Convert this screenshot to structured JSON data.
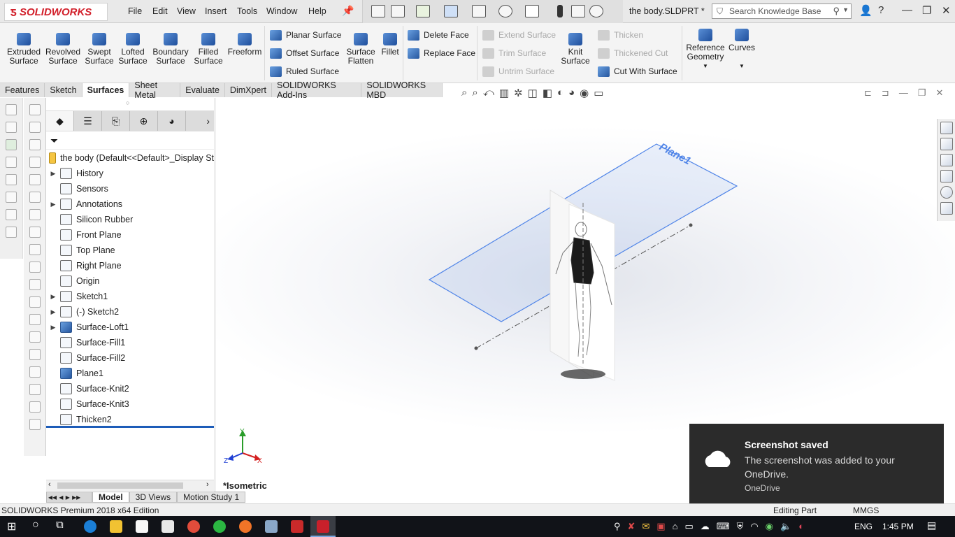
{
  "app": {
    "logo_text": "SOLIDWORKS",
    "document_title": "the body.SLDPRT *",
    "menu": [
      "File",
      "Edit",
      "View",
      "Insert",
      "Tools",
      "Window",
      "Help"
    ],
    "search_placeholder": "Search Knowledge Base"
  },
  "commands": {
    "large": [
      "Extruded\nSurface",
      "Revolved\nSurface",
      "Swept\nSurface",
      "Lofted\nSurface",
      "Boundary\nSurface",
      "Filled\nSurface",
      "Freeform"
    ],
    "group1": [
      "Planar Surface",
      "Offset Surface",
      "Ruled Surface"
    ],
    "surface_flatten": "Surface\nFlatten",
    "fillet": "Fillet",
    "group2": [
      "Delete Face",
      "Replace Face"
    ],
    "group3_disabled": [
      "Extend Surface",
      "Trim Surface",
      "Untrim Surface"
    ],
    "knit_surface": "Knit\nSurface",
    "group4": [
      {
        "label": "Thicken",
        "enabled": false
      },
      {
        "label": "Thickened Cut",
        "enabled": false
      },
      {
        "label": "Cut With Surface",
        "enabled": true
      }
    ],
    "reference_geometry": "Reference\nGeometry",
    "curves": "Curves"
  },
  "tabs": [
    "Features",
    "Sketch",
    "Surfaces",
    "Sheet Metal",
    "Evaluate",
    "DimXpert",
    "SOLIDWORKS Add-Ins",
    "SOLIDWORKS MBD"
  ],
  "active_tab": "Surfaces",
  "feature_tree": {
    "root": "the body  (Default<<Default>_Display St",
    "nodes": [
      {
        "label": "History",
        "expandable": true
      },
      {
        "label": "Sensors",
        "expandable": false
      },
      {
        "label": "Annotations",
        "expandable": true
      },
      {
        "label": "Silicon Rubber",
        "expandable": false
      },
      {
        "label": "Front Plane",
        "expandable": false
      },
      {
        "label": "Top Plane",
        "expandable": false
      },
      {
        "label": "Right Plane",
        "expandable": false
      },
      {
        "label": "Origin",
        "expandable": false
      },
      {
        "label": "Sketch1",
        "expandable": true
      },
      {
        "label": "(-) Sketch2",
        "expandable": true
      },
      {
        "label": "Surface-Loft1",
        "expandable": true
      },
      {
        "label": "Surface-Fill1",
        "expandable": false
      },
      {
        "label": "Surface-Fill2",
        "expandable": false
      },
      {
        "label": "Plane1",
        "expandable": false
      },
      {
        "label": "Surface-Knit2",
        "expandable": false
      },
      {
        "label": "Surface-Knit3",
        "expandable": false
      },
      {
        "label": "Thicken2",
        "expandable": false
      }
    ]
  },
  "bottom_tabs": [
    "Model",
    "3D Views",
    "Motion Study 1"
  ],
  "active_bottom_tab": "Model",
  "viewport": {
    "view_name": "*Isometric",
    "plane_label": "Plane1",
    "triad": {
      "x": "X",
      "y": "Y",
      "z": "Z"
    }
  },
  "toast": {
    "title": "Screenshot saved",
    "body": "The screenshot was added to your OneDrive.",
    "app": "OneDrive"
  },
  "status": {
    "edition": "SOLIDWORKS Premium 2018 x64 Edition",
    "mode": "Editing Part",
    "units": "MMGS"
  },
  "taskbar": {
    "language": "ENG",
    "time": "1:45 PM"
  },
  "colors": {
    "brand_red": "#d2202b",
    "plane_blue": "#4f84e8",
    "toast_bg": "#2b2b2b",
    "taskbar_bg": "#111318"
  }
}
